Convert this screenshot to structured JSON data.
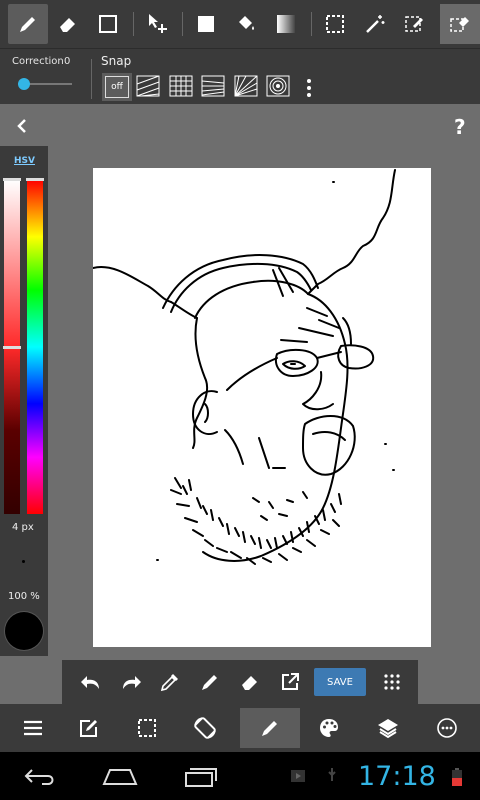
{
  "options": {
    "correction_label": "Correction",
    "correction_value": "0",
    "snap_label": "Snap",
    "snap_off_label": "off"
  },
  "color_panel": {
    "mode_label": "HSV",
    "brush_size": "4 px",
    "opacity": "100 %",
    "current_color": "#000000"
  },
  "edit_bar": {
    "save_label": "SAVE"
  },
  "system": {
    "time": "17:18"
  },
  "colors": {
    "accent": "#3d7ab3",
    "time": "#33b5e5"
  }
}
